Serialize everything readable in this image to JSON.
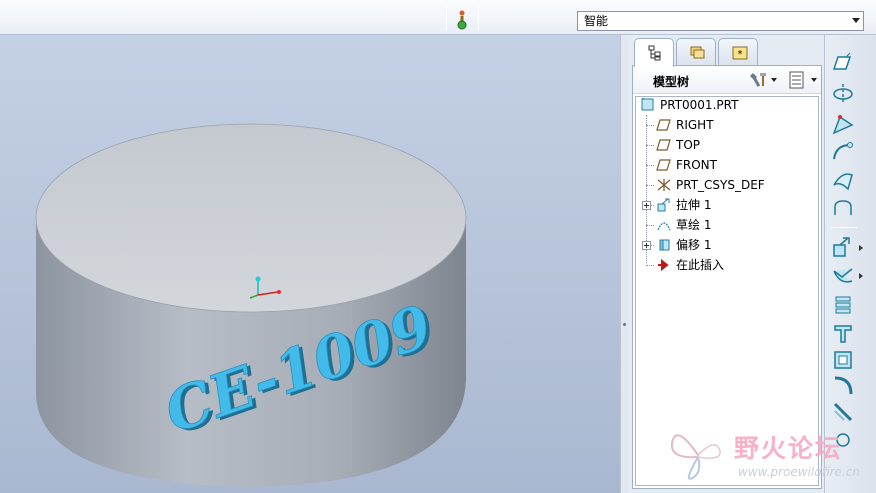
{
  "toolbar": {
    "filter_value": "智能"
  },
  "viewport": {
    "model_text": "CE-1009",
    "colors": {
      "body": "#a8b1bd",
      "top_face": "#c9ced5",
      "text": "#3fb6e6"
    }
  },
  "navigator": {
    "tabs": [
      "model-tree-tab",
      "folder-browser-tab",
      "favorites-tab"
    ],
    "tree_title": "模型树",
    "tree_items": [
      {
        "label": "PRT0001.PRT",
        "icon": "part-icon"
      },
      {
        "label": "RIGHT",
        "icon": "datum-plane-icon"
      },
      {
        "label": "TOP",
        "icon": "datum-plane-icon"
      },
      {
        "label": "FRONT",
        "icon": "datum-plane-icon"
      },
      {
        "label": "PRT_CSYS_DEF",
        "icon": "coordinate-system-icon"
      },
      {
        "label": "拉伸 1",
        "icon": "extrude-icon"
      },
      {
        "label": "草绘 1",
        "icon": "sketch-icon"
      },
      {
        "label": "偏移 1",
        "icon": "offset-icon"
      },
      {
        "label": "在此插入",
        "icon": "insert-here-icon"
      }
    ]
  },
  "watermark": {
    "title": "野火论坛",
    "url": "www.proewildfire.cn"
  }
}
